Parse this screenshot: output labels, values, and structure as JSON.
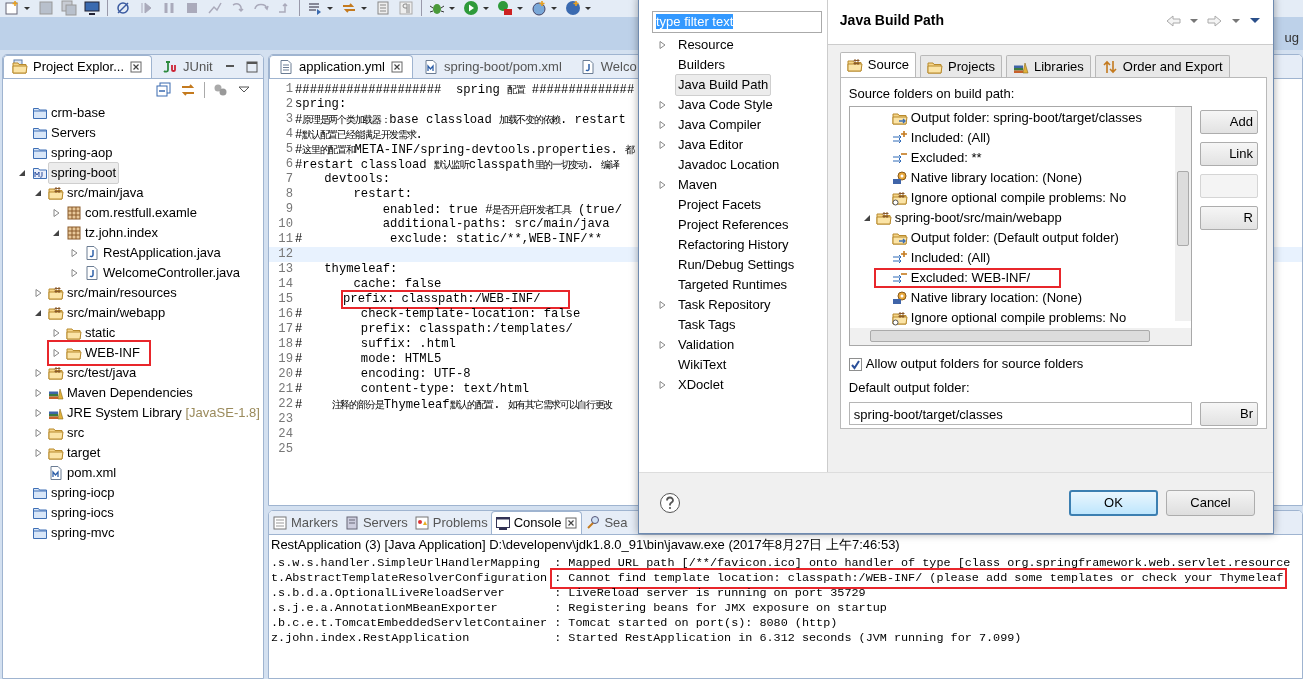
{
  "toolbar": {
    "perspective_label": "ug"
  },
  "project_explorer": {
    "tabs": [
      {
        "label": "Project Explor...",
        "selected": true,
        "kind": "explorer"
      },
      {
        "label": "JUnit",
        "selected": false,
        "kind": "junit"
      }
    ],
    "tree": [
      {
        "label": "crm-base",
        "kind": "project",
        "selected": false,
        "highlight": false
      },
      {
        "label": "Servers",
        "kind": "project",
        "selected": false,
        "highlight": false
      },
      {
        "label": "spring-aop",
        "kind": "project",
        "selected": false,
        "highlight": false
      },
      {
        "label": "spring-boot",
        "kind": "maven-project",
        "selected": true,
        "highlight": false,
        "expanded": true,
        "children": [
          {
            "label": "src/main/java",
            "kind": "srcfolder",
            "selected": false,
            "highlight": false,
            "expanded": true,
            "children": [
              {
                "label": "com.restfull.examle",
                "kind": "package",
                "selected": false,
                "highlight": false,
                "expanded": false
              },
              {
                "label": "tz.john.index",
                "kind": "package",
                "selected": false,
                "highlight": false,
                "expanded": true,
                "children": [
                  {
                    "label": "RestApplication.java",
                    "kind": "java",
                    "selected": false,
                    "highlight": false,
                    "expanded": false
                  },
                  {
                    "label": "WelcomeController.java",
                    "kind": "java",
                    "selected": false,
                    "highlight": false,
                    "expanded": false
                  }
                ]
              }
            ]
          },
          {
            "label": "src/main/resources",
            "kind": "srcfolder",
            "selected": false,
            "highlight": false,
            "expanded": false
          },
          {
            "label": "src/main/webapp",
            "kind": "srcfolder",
            "selected": false,
            "highlight": false,
            "expanded": true,
            "children": [
              {
                "label": "static",
                "kind": "folder",
                "selected": false,
                "highlight": false,
                "expanded": false
              },
              {
                "label": "WEB-INF",
                "kind": "folder",
                "selected": false,
                "highlight": true,
                "expanded": false
              }
            ]
          },
          {
            "label": "src/test/java",
            "kind": "srcfolder",
            "selected": false,
            "highlight": false,
            "expanded": false
          },
          {
            "label": "Maven Dependencies",
            "kind": "library",
            "selected": false,
            "highlight": false,
            "expanded": false
          },
          {
            "label": "JRE System Library",
            "decoration": "[JavaSE-1.8]",
            "kind": "library",
            "selected": false,
            "highlight": false,
            "expanded": false
          },
          {
            "label": "src",
            "kind": "folder",
            "selected": false,
            "highlight": false,
            "expanded": false
          },
          {
            "label": "target",
            "kind": "folder",
            "selected": false,
            "highlight": false,
            "expanded": false
          },
          {
            "label": "pom.xml",
            "kind": "xml",
            "selected": false,
            "highlight": false
          }
        ]
      },
      {
        "label": "spring-iocp",
        "kind": "project",
        "selected": false,
        "highlight": false
      },
      {
        "label": "spring-iocs",
        "kind": "project",
        "selected": false,
        "highlight": false
      },
      {
        "label": "spring-mvc",
        "kind": "project",
        "selected": false,
        "highlight": false
      }
    ]
  },
  "editor": {
    "tabs": [
      {
        "label": "application.yml",
        "selected": true,
        "kind": "text"
      },
      {
        "label": "spring-boot/pom.xml",
        "selected": false,
        "kind": "xml"
      },
      {
        "label": "Welco",
        "selected": false,
        "kind": "java"
      }
    ],
    "lines": [
      {
        "number": "1",
        "text": "####################  spring 配置 ##############",
        "current": false,
        "highlight": false
      },
      {
        "number": "2",
        "text": "spring:",
        "current": false,
        "highlight": false
      },
      {
        "number": "3",
        "text": "#原理是两个类加载器：base classload 加载不变的依赖. restart",
        "current": false,
        "highlight": false
      },
      {
        "number": "4",
        "text": "#默认配置已经能满足开发需求.",
        "current": false,
        "highlight": false
      },
      {
        "number": "5",
        "text": "#这里的配置和META-INF/spring-devtools.properties. 都",
        "current": false,
        "highlight": false
      },
      {
        "number": "6",
        "text": "#restart classload 默认监听classpath里的一切变动. 编译",
        "current": false,
        "highlight": false
      },
      {
        "number": "7",
        "text": "    devtools:",
        "current": false,
        "highlight": false
      },
      {
        "number": "8",
        "text": "        restart:",
        "current": false,
        "highlight": false
      },
      {
        "number": "9",
        "text": "            enabled: true #是否开启开发者工具 (true/",
        "current": false,
        "highlight": false
      },
      {
        "number": "10",
        "text": "            additional-paths: src/main/java",
        "current": false,
        "highlight": false
      },
      {
        "number": "11",
        "text": "#            exclude: static/**,WEB-INF/**",
        "current": false,
        "highlight": false
      },
      {
        "number": "12",
        "current": true,
        "highlight": false
      },
      {
        "number": "13",
        "text": "    thymeleaf:",
        "current": false,
        "highlight": false
      },
      {
        "number": "14",
        "text": "        cache: false",
        "current": false,
        "highlight": false
      },
      {
        "number": "15",
        "text": "        prefix: classpath:/WEB-INF/",
        "current": false,
        "highlight": true
      },
      {
        "number": "16",
        "text": "#        check-template-location: false",
        "current": false,
        "highlight": false
      },
      {
        "number": "17",
        "text": "#        prefix: classpath:/templates/",
        "current": false,
        "highlight": false
      },
      {
        "number": "18",
        "text": "#        suffix: .html",
        "current": false,
        "highlight": false
      },
      {
        "number": "19",
        "text": "#        mode: HTML5",
        "current": false,
        "highlight": false
      },
      {
        "number": "20",
        "text": "#        encoding: UTF-8",
        "current": false,
        "highlight": false
      },
      {
        "number": "21",
        "text": "#        content-type: text/html",
        "current": false,
        "highlight": false
      },
      {
        "number": "22",
        "text": "#    注释的部分是Thymeleaf默认的配置. 如有其它需求可以自行更改",
        "current": false,
        "highlight": false
      },
      {
        "number": "23",
        "current": false,
        "highlight": false
      },
      {
        "number": "24",
        "current": false,
        "highlight": false
      },
      {
        "number": "25",
        "current": false,
        "highlight": false
      }
    ]
  },
  "console": {
    "tabs": [
      {
        "label": "Markers",
        "selected": false,
        "kind": "markers"
      },
      {
        "label": "Servers",
        "selected": false,
        "kind": "servers"
      },
      {
        "label": "Problems",
        "selected": false,
        "kind": "problems"
      },
      {
        "label": "Console",
        "selected": true,
        "kind": "console"
      },
      {
        "label": "Sea",
        "selected": false,
        "kind": "search"
      }
    ],
    "header": "RestApplication (3) [Java Application] D:\\developenv\\jdk1.8.0_91\\bin\\javaw.exe (2017年8月27日 上午7:46:53)",
    "lines": [
      {
        "logger": ".s.w.s.handler.SimpleUrlHandlerMapping",
        "message": ": Mapped URL path [/**/favicon.ico] onto handler of type [class org.springframework.web.servlet.resource",
        "highlight": false
      },
      {
        "logger": "t.AbstractTemplateResolverConfiguration",
        "message": ": Cannot find template location: classpath:/WEB-INF/ (please add some templates or check your Thymeleaf",
        "highlight": true
      },
      {
        "logger": ".s.b.d.a.OptionalLiveReloadServer",
        "message": ": LiveReload server is running on port 35729",
        "highlight": false
      },
      {
        "logger": ".s.j.e.a.AnnotationMBeanExporter",
        "message": ": Registering beans for JMX exposure on startup",
        "highlight": false
      },
      {
        "logger": ".b.c.e.t.TomcatEmbeddedServletContainer",
        "message": ": Tomcat started on port(s): 8080 (http)",
        "highlight": false
      },
      {
        "logger": "z.john.index.RestApplication",
        "message": ": Started RestApplication in 6.312 seconds (JVM running for 7.099)",
        "highlight": false
      }
    ]
  },
  "dialog": {
    "filter": {
      "value": "type filter text",
      "selected": true
    },
    "nav": [
      {
        "label": "Resource",
        "expanded": false,
        "selected": false
      },
      {
        "label": "Builders",
        "selected": false
      },
      {
        "label": "Java Build Path",
        "selected": true
      },
      {
        "label": "Java Code Style",
        "expanded": false,
        "selected": false
      },
      {
        "label": "Java Compiler",
        "expanded": false,
        "selected": false
      },
      {
        "label": "Java Editor",
        "expanded": false,
        "selected": false
      },
      {
        "label": "Javadoc Location",
        "selected": false
      },
      {
        "label": "Maven",
        "expanded": false,
        "selected": false
      },
      {
        "label": "Project Facets",
        "selected": false
      },
      {
        "label": "Project References",
        "selected": false
      },
      {
        "label": "Refactoring History",
        "selected": false
      },
      {
        "label": "Run/Debug Settings",
        "selected": false
      },
      {
        "label": "Targeted Runtimes",
        "selected": false
      },
      {
        "label": "Task Repository",
        "expanded": false,
        "selected": false
      },
      {
        "label": "Task Tags",
        "selected": false
      },
      {
        "label": "Validation",
        "expanded": false,
        "selected": false
      },
      {
        "label": "WikiText",
        "selected": false
      },
      {
        "label": "XDoclet",
        "expanded": false,
        "selected": false
      }
    ],
    "title": "Java Build Path",
    "tabs": [
      {
        "label": "Source",
        "selected": true,
        "kind": "source"
      },
      {
        "label": "Projects",
        "selected": false,
        "kind": "projects"
      },
      {
        "label": "Libraries",
        "selected": false,
        "kind": "libraries"
      },
      {
        "label": "Order and Export",
        "selected": false,
        "kind": "order"
      }
    ],
    "list_label": "Source folders on build path:",
    "source_tree": [
      {
        "children": [
          {
            "label": "Output folder: spring-boot/target/classes",
            "kind": "output",
            "highlight": false
          },
          {
            "label": "Included: (All)",
            "kind": "included",
            "highlight": false
          },
          {
            "label": "Excluded: **",
            "kind": "excluded",
            "highlight": false
          },
          {
            "label": "Native library location: (None)",
            "kind": "native",
            "highlight": false
          },
          {
            "label": "Ignore optional compile problems: No",
            "kind": "ignore",
            "highlight": false
          }
        ]
      },
      {
        "label": "spring-boot/src/main/webapp",
        "kind": "source",
        "expanded": true,
        "highlight": false,
        "children": [
          {
            "label": "Output folder: (Default output folder)",
            "kind": "output",
            "highlight": false
          },
          {
            "label": "Included: (All)",
            "kind": "included",
            "highlight": false
          },
          {
            "label": "Excluded: WEB-INF/",
            "kind": "excluded",
            "highlight": true
          },
          {
            "label": "Native library location: (None)",
            "kind": "native",
            "highlight": false
          },
          {
            "label": "Ignore optional compile problems: No",
            "kind": "ignore",
            "highlight": false
          }
        ]
      }
    ],
    "side_buttons": [
      {
        "label": "Add",
        "disabled": false
      },
      {
        "label": "Link",
        "disabled": false
      },
      {
        "disabled": true
      },
      {
        "label": "R",
        "disabled": false
      }
    ],
    "allow_output": {
      "label": "Allow output folders for source folders",
      "checked": true
    },
    "output_label": "Default output folder:",
    "output_value": "spring-boot/target/classes",
    "browse_button": "Br",
    "buttons": [
      {
        "label": "OK",
        "default": true
      },
      {
        "label": "Cancel",
        "default": false
      }
    ]
  }
}
